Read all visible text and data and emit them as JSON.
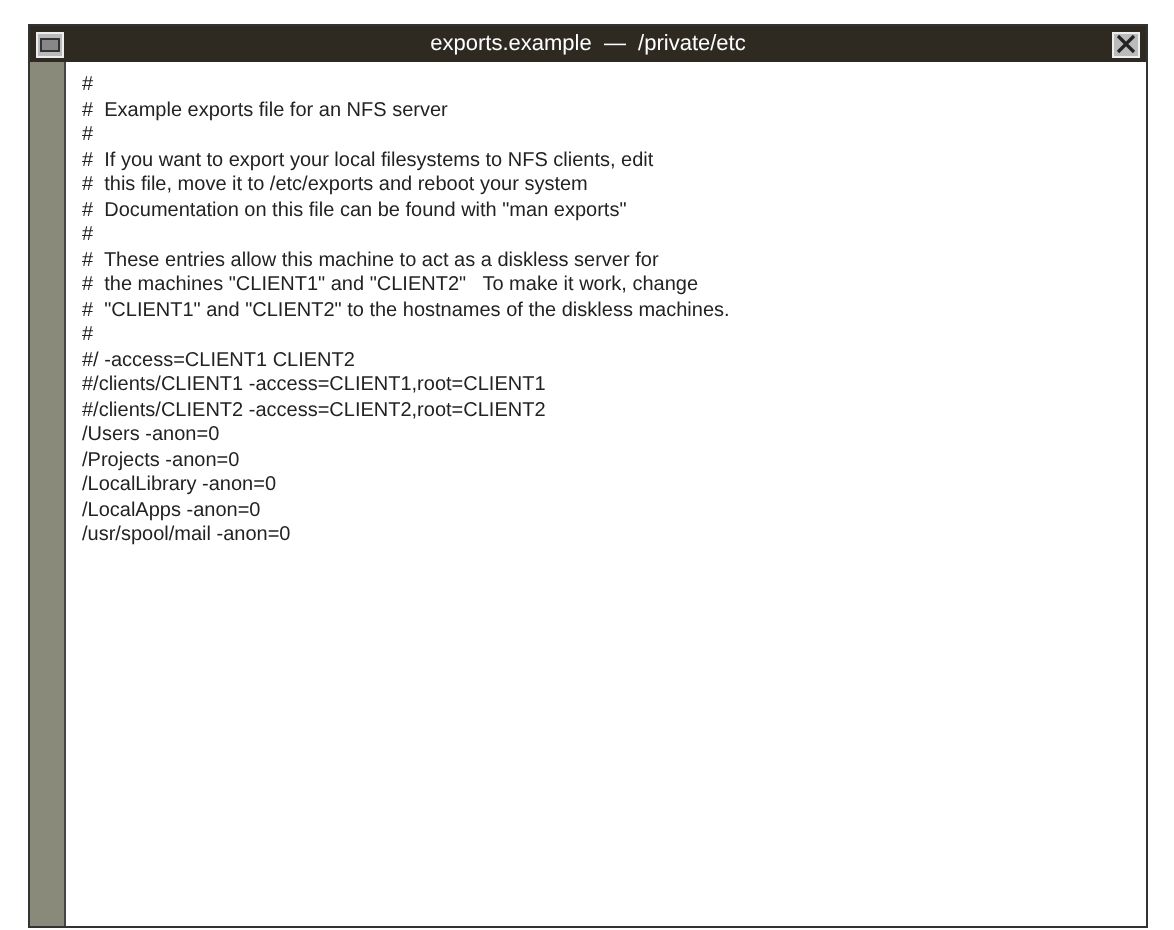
{
  "window": {
    "title": "exports.example  —  /private/etc"
  },
  "lines": [
    "#",
    "#  Example exports file for an NFS server",
    "#",
    "#  If you want to export your local filesystems to NFS clients, edit",
    "#  this file, move it to /etc/exports and reboot your system",
    "#  Documentation on this file can be found with \"man exports\"",
    "#",
    "#  These entries allow this machine to act as a diskless server for",
    "#  the machines \"CLIENT1\" and \"CLIENT2\"   To make it work, change",
    "#  \"CLIENT1\" and \"CLIENT2\" to the hostnames of the diskless machines.",
    "#",
    "#/ -access=CLIENT1 CLIENT2",
    "#/clients/CLIENT1 -access=CLIENT1,root=CLIENT1",
    "#/clients/CLIENT2 -access=CLIENT2,root=CLIENT2",
    "/Users -anon=0",
    "/Projects -anon=0",
    "/LocalLibrary -anon=0",
    "/LocalApps -anon=0",
    "/usr/spool/mail -anon=0"
  ]
}
